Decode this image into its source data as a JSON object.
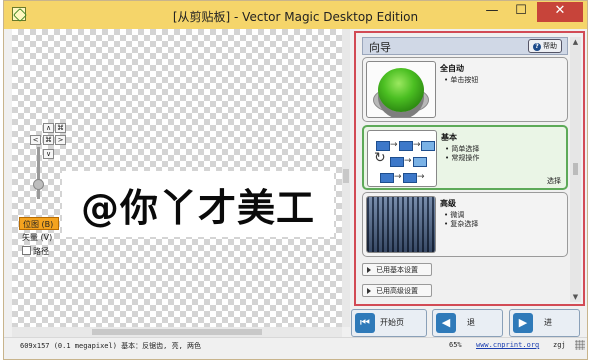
{
  "window": {
    "title": "[从剪贴板] - Vector Magic Desktop Edition",
    "min_label": "—",
    "max_label": "☐",
    "close_label": "✕"
  },
  "canvas": {
    "artwork_text": "@你丫才美工"
  },
  "navigation": {
    "up": "∧",
    "fit": "⌘",
    "left": "<",
    "center": "⌘",
    "right": ">",
    "down": "∨"
  },
  "view_modes": {
    "bitmap": "位图 (B)",
    "vector": "矢量 (V)",
    "paths": "路径"
  },
  "panel": {
    "title": "向导",
    "help_label": "帮助",
    "cards": [
      {
        "title": "全自动",
        "bullets": [
          "• 单击按钮"
        ],
        "selected": false
      },
      {
        "title": "基本",
        "bullets": [
          "• 简单选择",
          "• 常规操作"
        ],
        "selected": true,
        "choose_label": "选择"
      },
      {
        "title": "高级",
        "bullets": [
          "• 微调",
          "• 复杂选择"
        ],
        "selected": false
      }
    ],
    "settings_basic": "已用基本设置",
    "settings_advanced": "已用高级设置"
  },
  "bottom_buttons": {
    "start_label": "开始页",
    "back_label": "退",
    "next_label": "进"
  },
  "status": {
    "left_text": "609x157 (0.1 megapixel)  基本：反锯齿, 亮, 两色",
    "zoom": "65%",
    "link": "www.cnprint.org",
    "user": "zgj"
  },
  "colors": {
    "title_bar": "#f5d56a",
    "close_button": "#c7443a",
    "panel_border": "#d24b55",
    "selected_card": "#5daa58",
    "view_selected": "#f4a31f",
    "bottom_badge": "#2f7ab9"
  }
}
